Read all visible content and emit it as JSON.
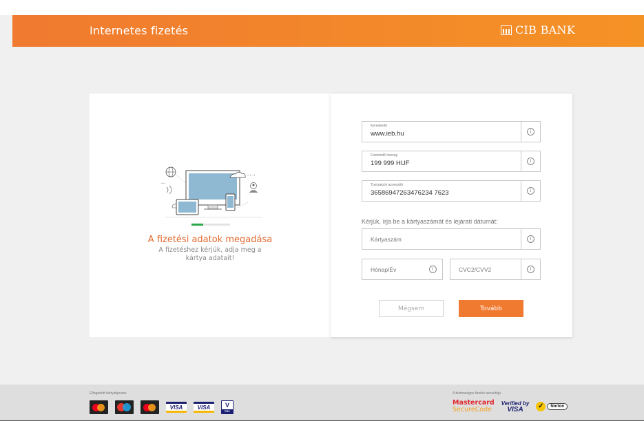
{
  "header": {
    "title": "Internetes fizetés",
    "brand": "CIB BANK",
    "color": "#f07a30"
  },
  "left_panel": {
    "illustration": "devices-illustration",
    "progress": 0.3,
    "title": "A fizetési adatok megadása",
    "subtitle": "A fizetéshez kérjük, adja meg a kártya adatait!"
  },
  "form": {
    "merchant": {
      "label": "Kereskedő",
      "value": "www.ieb.hu"
    },
    "amount": {
      "label": "Fizetendő összeg",
      "value": "199 999 HUF"
    },
    "transaction": {
      "label": "Tranzakció azonosító",
      "value": "36586947263476234 7623"
    },
    "prompt": "Kérjük, írja be a kártyaszámát és lejárati dátumát:",
    "card_number": {
      "placeholder": "Kártyaszám"
    },
    "expiry": {
      "placeholder": "Hónap/Év"
    },
    "cvc": {
      "placeholder": "CVC2/CVV2"
    },
    "info_glyph": "i",
    "cancel_label": "Mégsem",
    "next_label": "Tovább"
  },
  "footer": {
    "accepted_label": "Elfogadott kártyatípusok",
    "accepted_cards": [
      "mastercard-icon",
      "maestro-icon",
      "mastercard-icon",
      "visa-icon",
      "visa-electron-icon",
      "vpay-icon"
    ],
    "visa_text": "VISA",
    "vpay_text": "V",
    "vpay_sub": "PAY",
    "security_label": "A biztonságos fizetés tanusítója",
    "mastercard_sc_line1": "Mastercard",
    "mastercard_sc_line2": "SecureCode",
    "verified_line1": "Verified by",
    "verified_line2": "VISA",
    "norton_text": "Norton"
  }
}
